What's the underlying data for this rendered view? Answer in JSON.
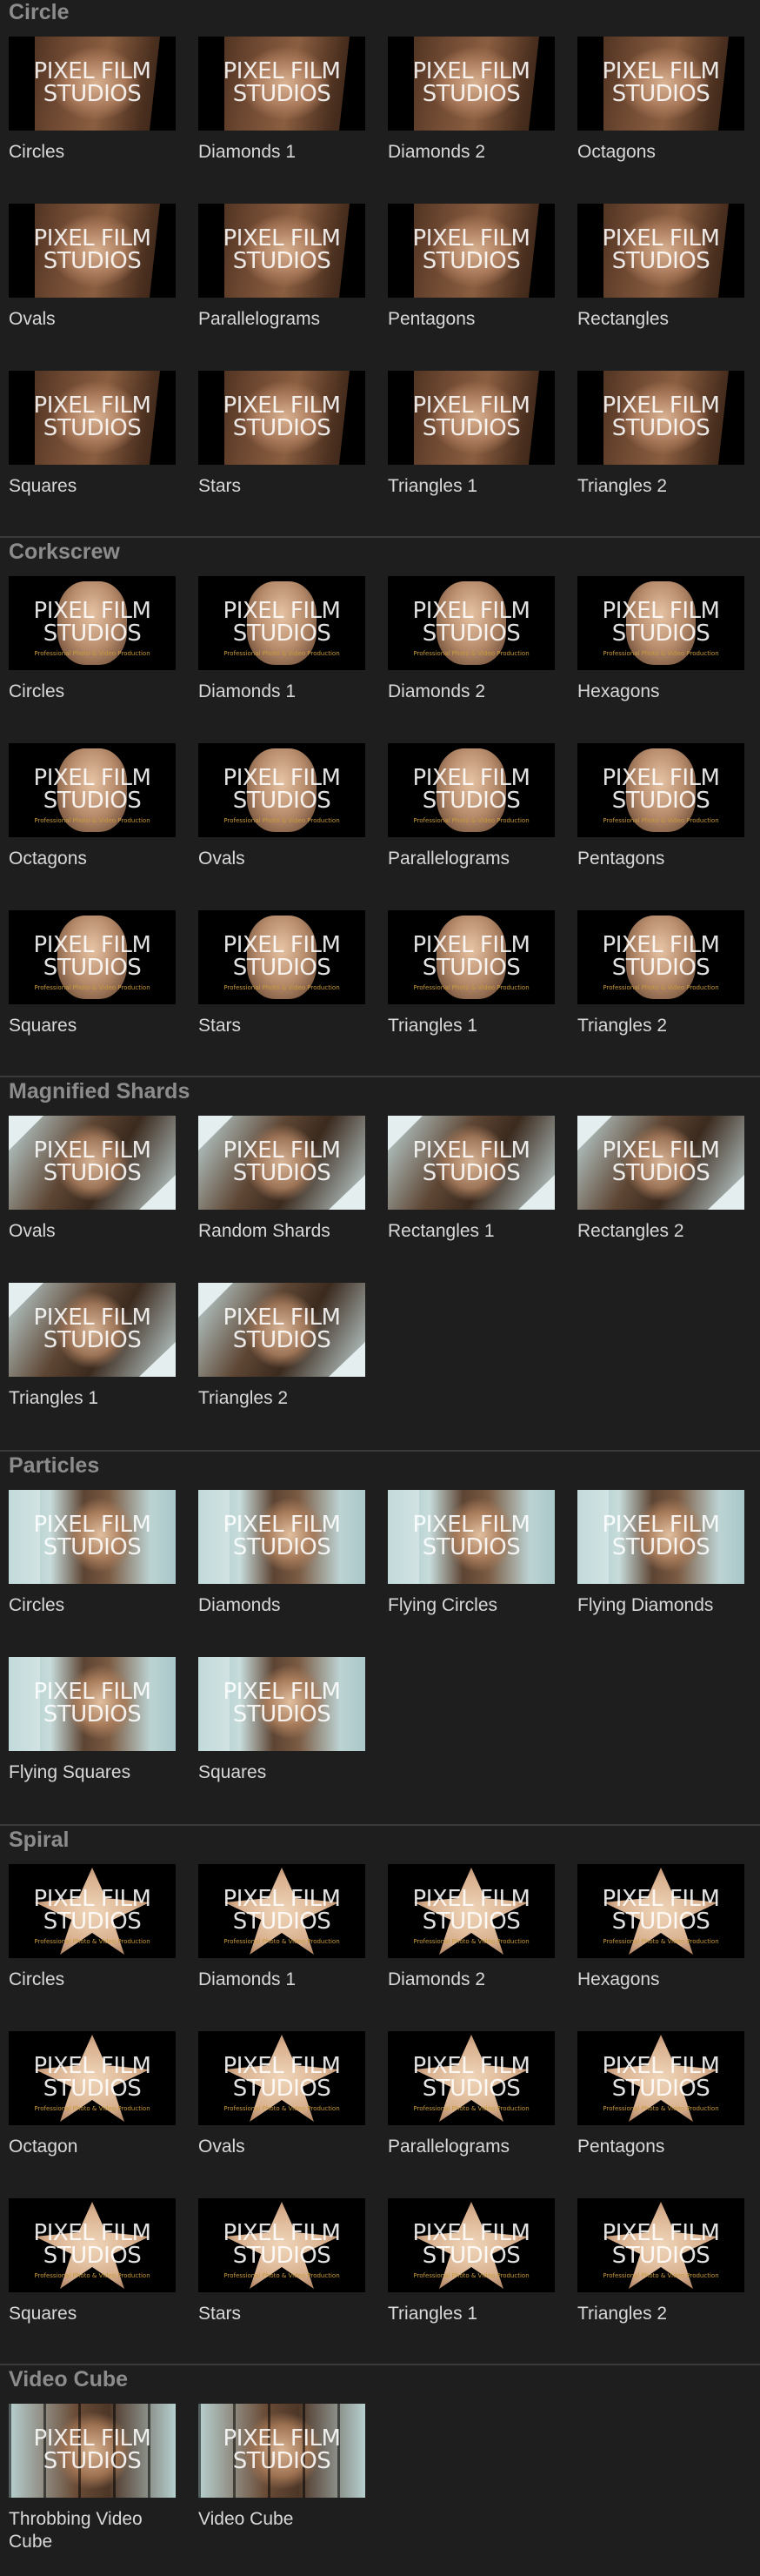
{
  "thumbnail_logo": {
    "line1": "PIXEL FILM",
    "line2": "STUDIOS",
    "tagline": "Professional Photo & Video Production"
  },
  "categories": [
    {
      "title": "Circle",
      "style": "face-warm",
      "items": [
        "Circles",
        "Diamonds 1",
        "Diamonds 2",
        "Octagons",
        "Ovals",
        "Parallelograms",
        "Pentagons",
        "Rectangles",
        "Squares",
        "Stars",
        "Triangles 1",
        "Triangles 2"
      ]
    },
    {
      "title": "Corkscrew",
      "style": "face-dark",
      "items": [
        "Circles",
        "Diamonds 1",
        "Diamonds 2",
        "Hexagons",
        "Octagons",
        "Ovals",
        "Parallelograms",
        "Pentagons",
        "Squares",
        "Stars",
        "Triangles 1",
        "Triangles 2"
      ]
    },
    {
      "title": "Magnified Shards",
      "style": "face-shard",
      "items": [
        "Ovals",
        "Random Shards",
        "Rectangles 1",
        "Rectangles 2",
        "Triangles 1",
        "Triangles 2"
      ]
    },
    {
      "title": "Particles",
      "style": "face-particle",
      "items": [
        "Circles",
        "Diamonds",
        "Flying Circles",
        "Flying Diamonds",
        "Flying Squares",
        "Squares"
      ]
    },
    {
      "title": "Spiral",
      "style": "face-spiral",
      "items": [
        "Circles",
        "Diamonds 1",
        "Diamonds 2",
        "Hexagons",
        "Octagon",
        "Ovals",
        "Parallelograms",
        "Pentagons",
        "Squares",
        "Stars",
        "Triangles 1",
        "Triangles 2"
      ]
    },
    {
      "title": "Video Cube",
      "style": "face-cube",
      "items": [
        "Throbbing Video Cube",
        "Video Cube"
      ]
    }
  ],
  "colors": {
    "background": "#1e1e1e",
    "header_text": "#8c8c8c",
    "label_text": "#d8d8d8",
    "separator": "#3a3a3a"
  }
}
